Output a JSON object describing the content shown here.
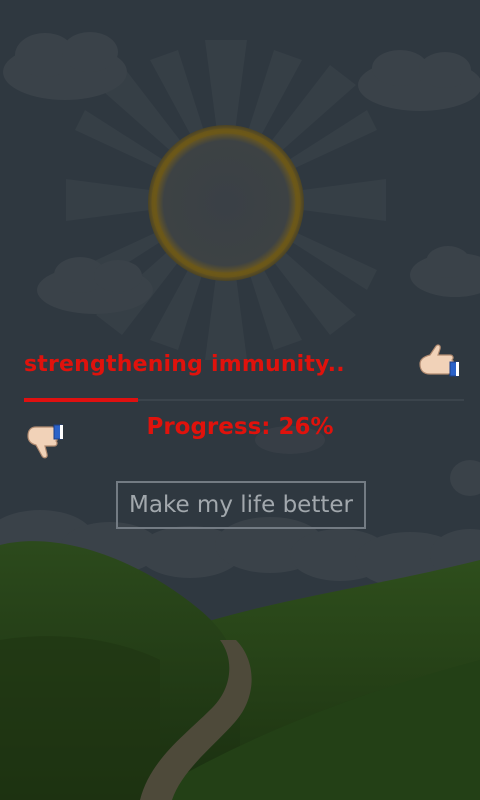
{
  "status": {
    "label": "strengthening immunity.."
  },
  "progress": {
    "label": "Progress: 26%",
    "value": 0.26
  },
  "cta": {
    "label": "Make my life better"
  },
  "icons": {
    "like": "thumbs-up-icon",
    "dislike": "thumbs-down-icon",
    "sun": "sun-icon"
  },
  "colors": {
    "accent": "#e0120c",
    "sky": "#2f3840",
    "hill": "#2b4a1a"
  }
}
